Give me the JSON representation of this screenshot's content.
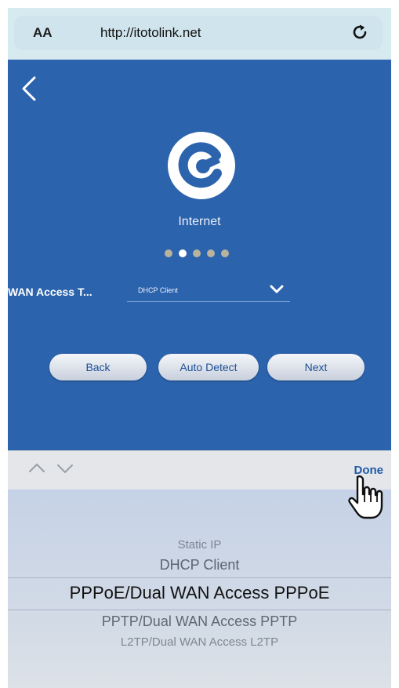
{
  "browser": {
    "text_size_label": "AA",
    "url": "http://itotolink.net",
    "icons": {
      "reload": "reload-icon"
    }
  },
  "page": {
    "back_icon": "chevron-left-icon",
    "logo_icon": "internet-logo-icon",
    "title": "Internet",
    "steps": {
      "total": 5,
      "current": 2
    },
    "wan_access": {
      "label": "WAN Access T...",
      "value": "DHCP Client",
      "chevron_icon": "chevron-down-icon"
    },
    "buttons": {
      "back": "Back",
      "auto_detect": "Auto Detect",
      "next": "Next"
    }
  },
  "picker": {
    "toolbar": {
      "prev_icon": "chevron-up-icon",
      "next_icon": "chevron-down-icon",
      "done": "Done"
    },
    "options": [
      "Static IP",
      "DHCP Client",
      "PPPoE/Dual WAN Access PPPoE",
      "PPTP/Dual WAN Access PPTP",
      "L2TP/Dual WAN Access L2TP"
    ],
    "selected_index": 2
  },
  "cursor": {
    "icon": "hand-pointer-icon"
  },
  "colors": {
    "page_bg": "#2c63ad",
    "button_text": "#1e4f93",
    "done_text": "#1f5aa8",
    "step_dot": "#b9b39d",
    "step_dot_active": "#ffffff"
  }
}
